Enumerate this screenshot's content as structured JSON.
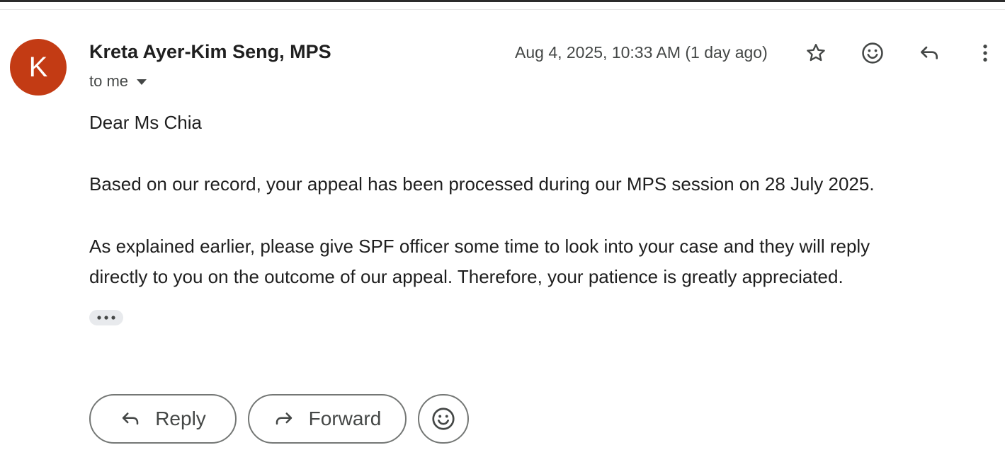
{
  "avatar": {
    "letter": "K",
    "color": "#c33b14"
  },
  "header": {
    "sender_name": "Kreta Ayer-Kim Seng, MPS",
    "recipient_label": "to me",
    "timestamp": "Aug 4, 2025, 10:33 AM (1 day ago)",
    "icons": [
      "star-icon",
      "emoji-reaction-icon",
      "reply-icon",
      "more-vert-icon"
    ]
  },
  "message": {
    "greeting": "Dear Ms Chia",
    "paragraph_1": "Based on our record, your appeal has been processed during our MPS session on 28 July 2025.",
    "paragraph_2_line_1": "As explained earlier, please give SPF officer some time to look into your case and they will reply",
    "paragraph_2_line_2": "directly to you on the outcome of our appeal. Therefore, your patience is greatly appreciated."
  },
  "actions": {
    "reply_label": "Reply",
    "forward_label": "Forward"
  }
}
